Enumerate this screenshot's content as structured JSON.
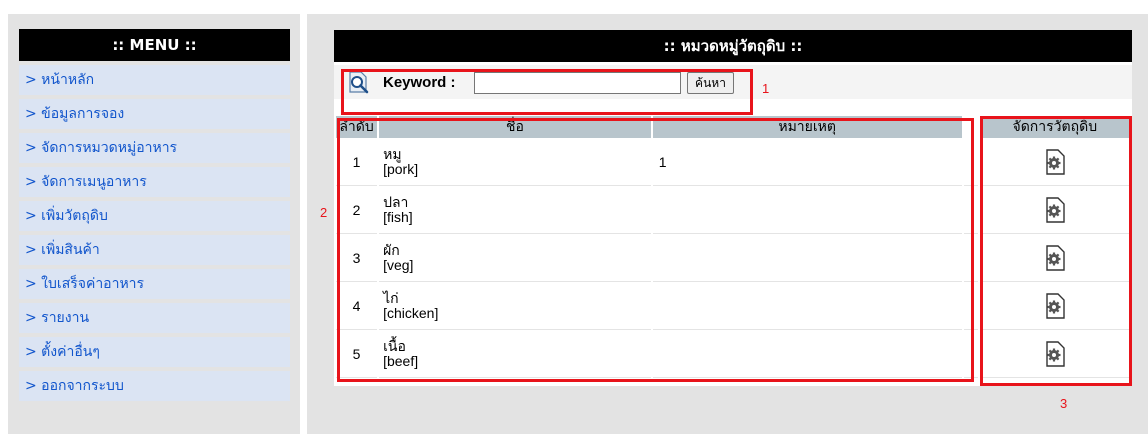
{
  "menu": {
    "title": ":: MENU ::",
    "items": [
      {
        "label": "> หน้าหลัก"
      },
      {
        "label": "> ข้อมูลการจอง"
      },
      {
        "label": "> จัดการหมวดหมู่อาหาร"
      },
      {
        "label": "> จัดการเมนูอาหาร"
      },
      {
        "label": "> เพิ่มวัตถุดิบ"
      },
      {
        "label": "> เพิ่มสินค้า"
      },
      {
        "label": "> ใบเสร็จค่าอาหาร"
      },
      {
        "label": "> รายงาน"
      },
      {
        "label": "> ตั้งค่าอื่นๆ"
      },
      {
        "label": "> ออกจากระบบ"
      }
    ]
  },
  "panel": {
    "title": ":: หมวดหมู่วัตถุดิบ ::"
  },
  "search": {
    "label": "Keyword :",
    "value": "",
    "placeholder": "",
    "button_label": "ค้นหา",
    "icon": "search-icon"
  },
  "table": {
    "headers": [
      "ลำดับ",
      "ชื่อ",
      "หมายเหตุ",
      "จัดการวัตถุดิบ"
    ],
    "rows": [
      {
        "no": "1",
        "name_th": "หมู",
        "name_en": "[pork]",
        "note": "1",
        "action_icon": "gear-icon"
      },
      {
        "no": "2",
        "name_th": "ปลา",
        "name_en": "[fish]",
        "note": "",
        "action_icon": "gear-icon"
      },
      {
        "no": "3",
        "name_th": "ผัก",
        "name_en": "[veg]",
        "note": "",
        "action_icon": "gear-icon"
      },
      {
        "no": "4",
        "name_th": "ไก่",
        "name_en": "[chicken]",
        "note": "",
        "action_icon": "gear-icon"
      },
      {
        "no": "5",
        "name_th": "เนื้อ",
        "name_en": "[beef]",
        "note": "",
        "action_icon": "gear-icon"
      }
    ]
  },
  "annotations": {
    "label_1": "1",
    "label_2": "2",
    "label_3": "3",
    "color": "#e8141b"
  }
}
